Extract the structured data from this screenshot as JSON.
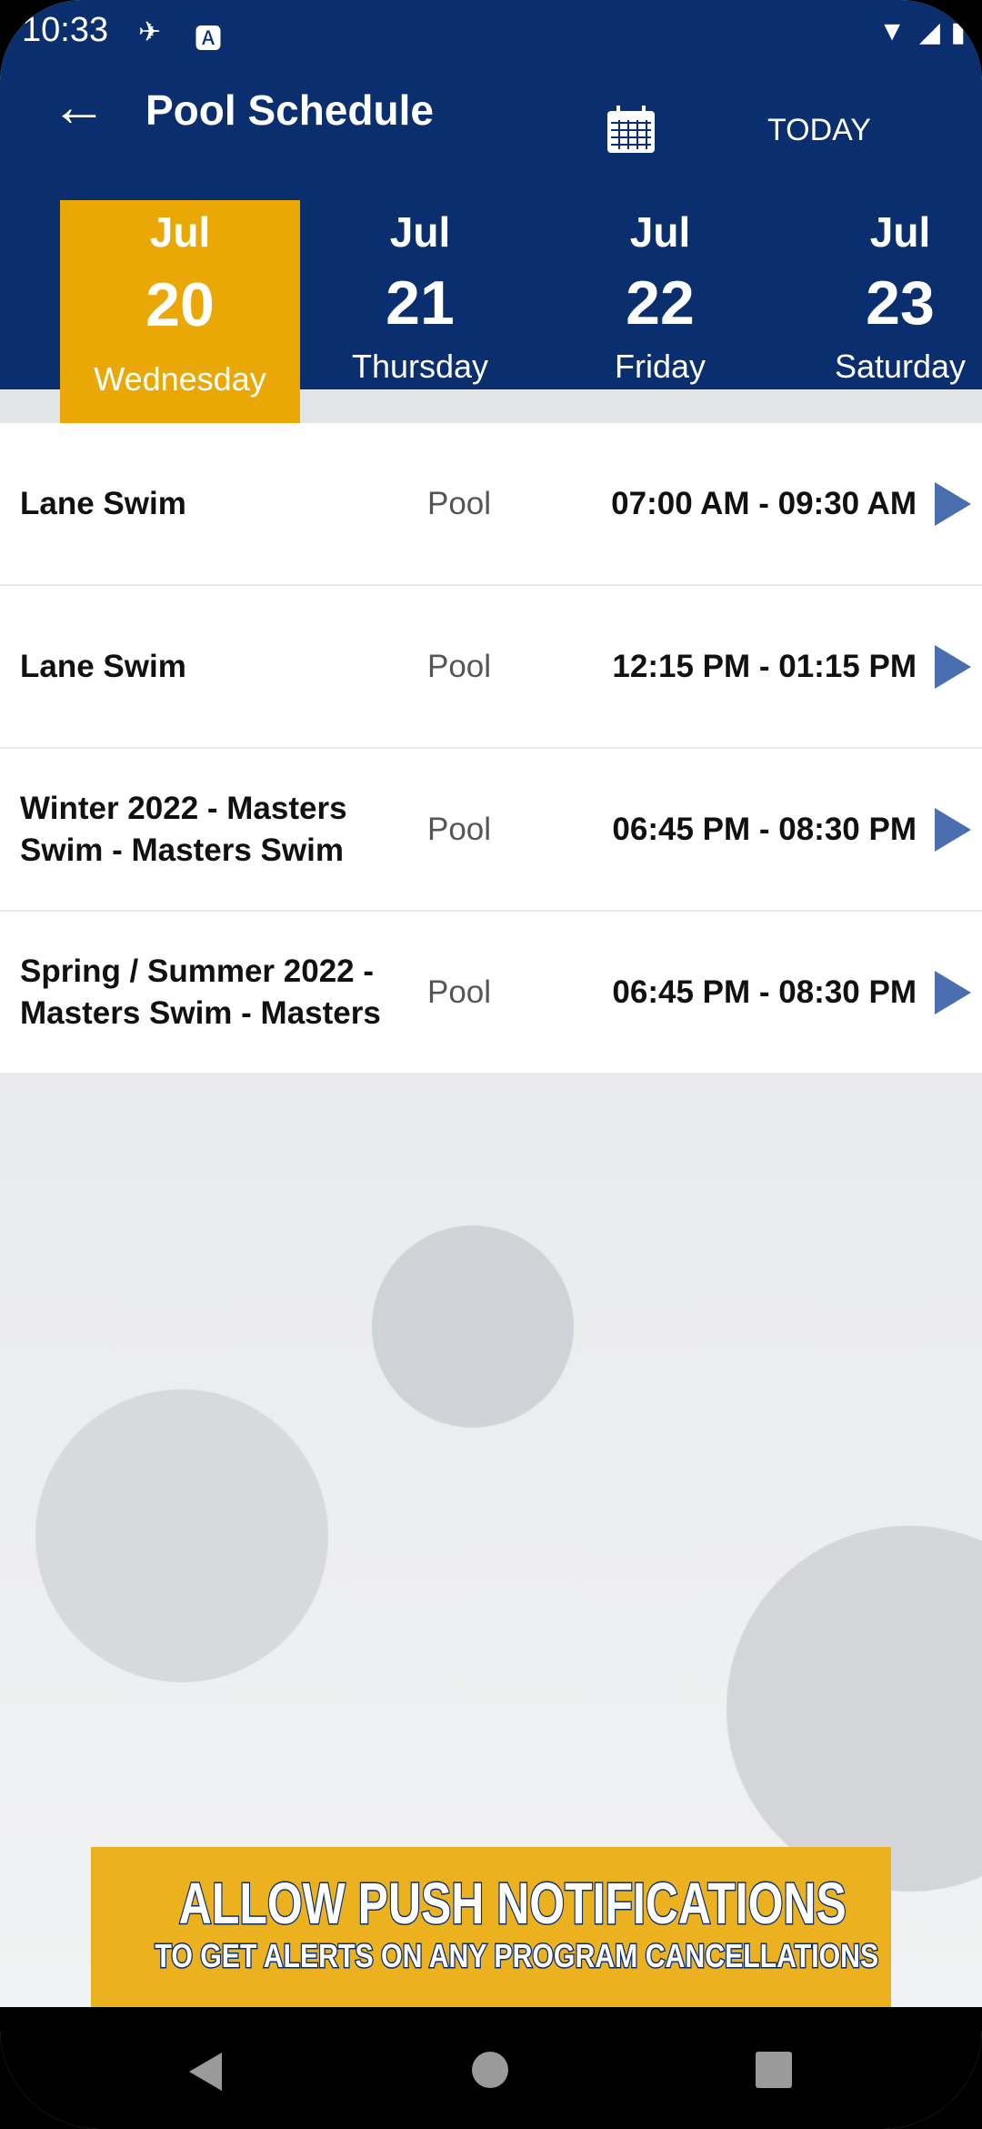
{
  "status_bar": {
    "time": "10:33"
  },
  "header": {
    "title": "Pool Schedule",
    "today_label": "TODAY"
  },
  "dates": [
    {
      "month": "Jul",
      "day": "20",
      "weekday": "Wednesday",
      "selected": true
    },
    {
      "month": "Jul",
      "day": "21",
      "weekday": "Thursday",
      "selected": false
    },
    {
      "month": "Jul",
      "day": "22",
      "weekday": "Friday",
      "selected": false
    },
    {
      "month": "Jul",
      "day": "23",
      "weekday": "Saturday",
      "selected": false
    }
  ],
  "sessions": [
    {
      "name": "Lane Swim",
      "location": "Pool",
      "time": "07:00 AM - 09:30 AM"
    },
    {
      "name": "Lane Swim",
      "location": "Pool",
      "time": "12:15 PM - 01:15 PM"
    },
    {
      "name": "Winter 2022 - Masters Swim - Masters Swim",
      "location": "Pool",
      "time": "06:45 PM - 08:30 PM"
    },
    {
      "name": "Spring / Summer 2022 - Masters Swim - Masters",
      "location": "Pool",
      "time": "06:45 PM - 08:30 PM"
    }
  ],
  "banner": {
    "line1": "ALLOW PUSH NOTIFICATIONS",
    "line2": "TO GET ALERTS ON ANY PROGRAM CANCELLATIONS"
  },
  "colors": {
    "header": "#0a2e6e",
    "selected_date": "#eaa806",
    "arrow": "#4a6eb0",
    "banner": "#ecb11f"
  }
}
